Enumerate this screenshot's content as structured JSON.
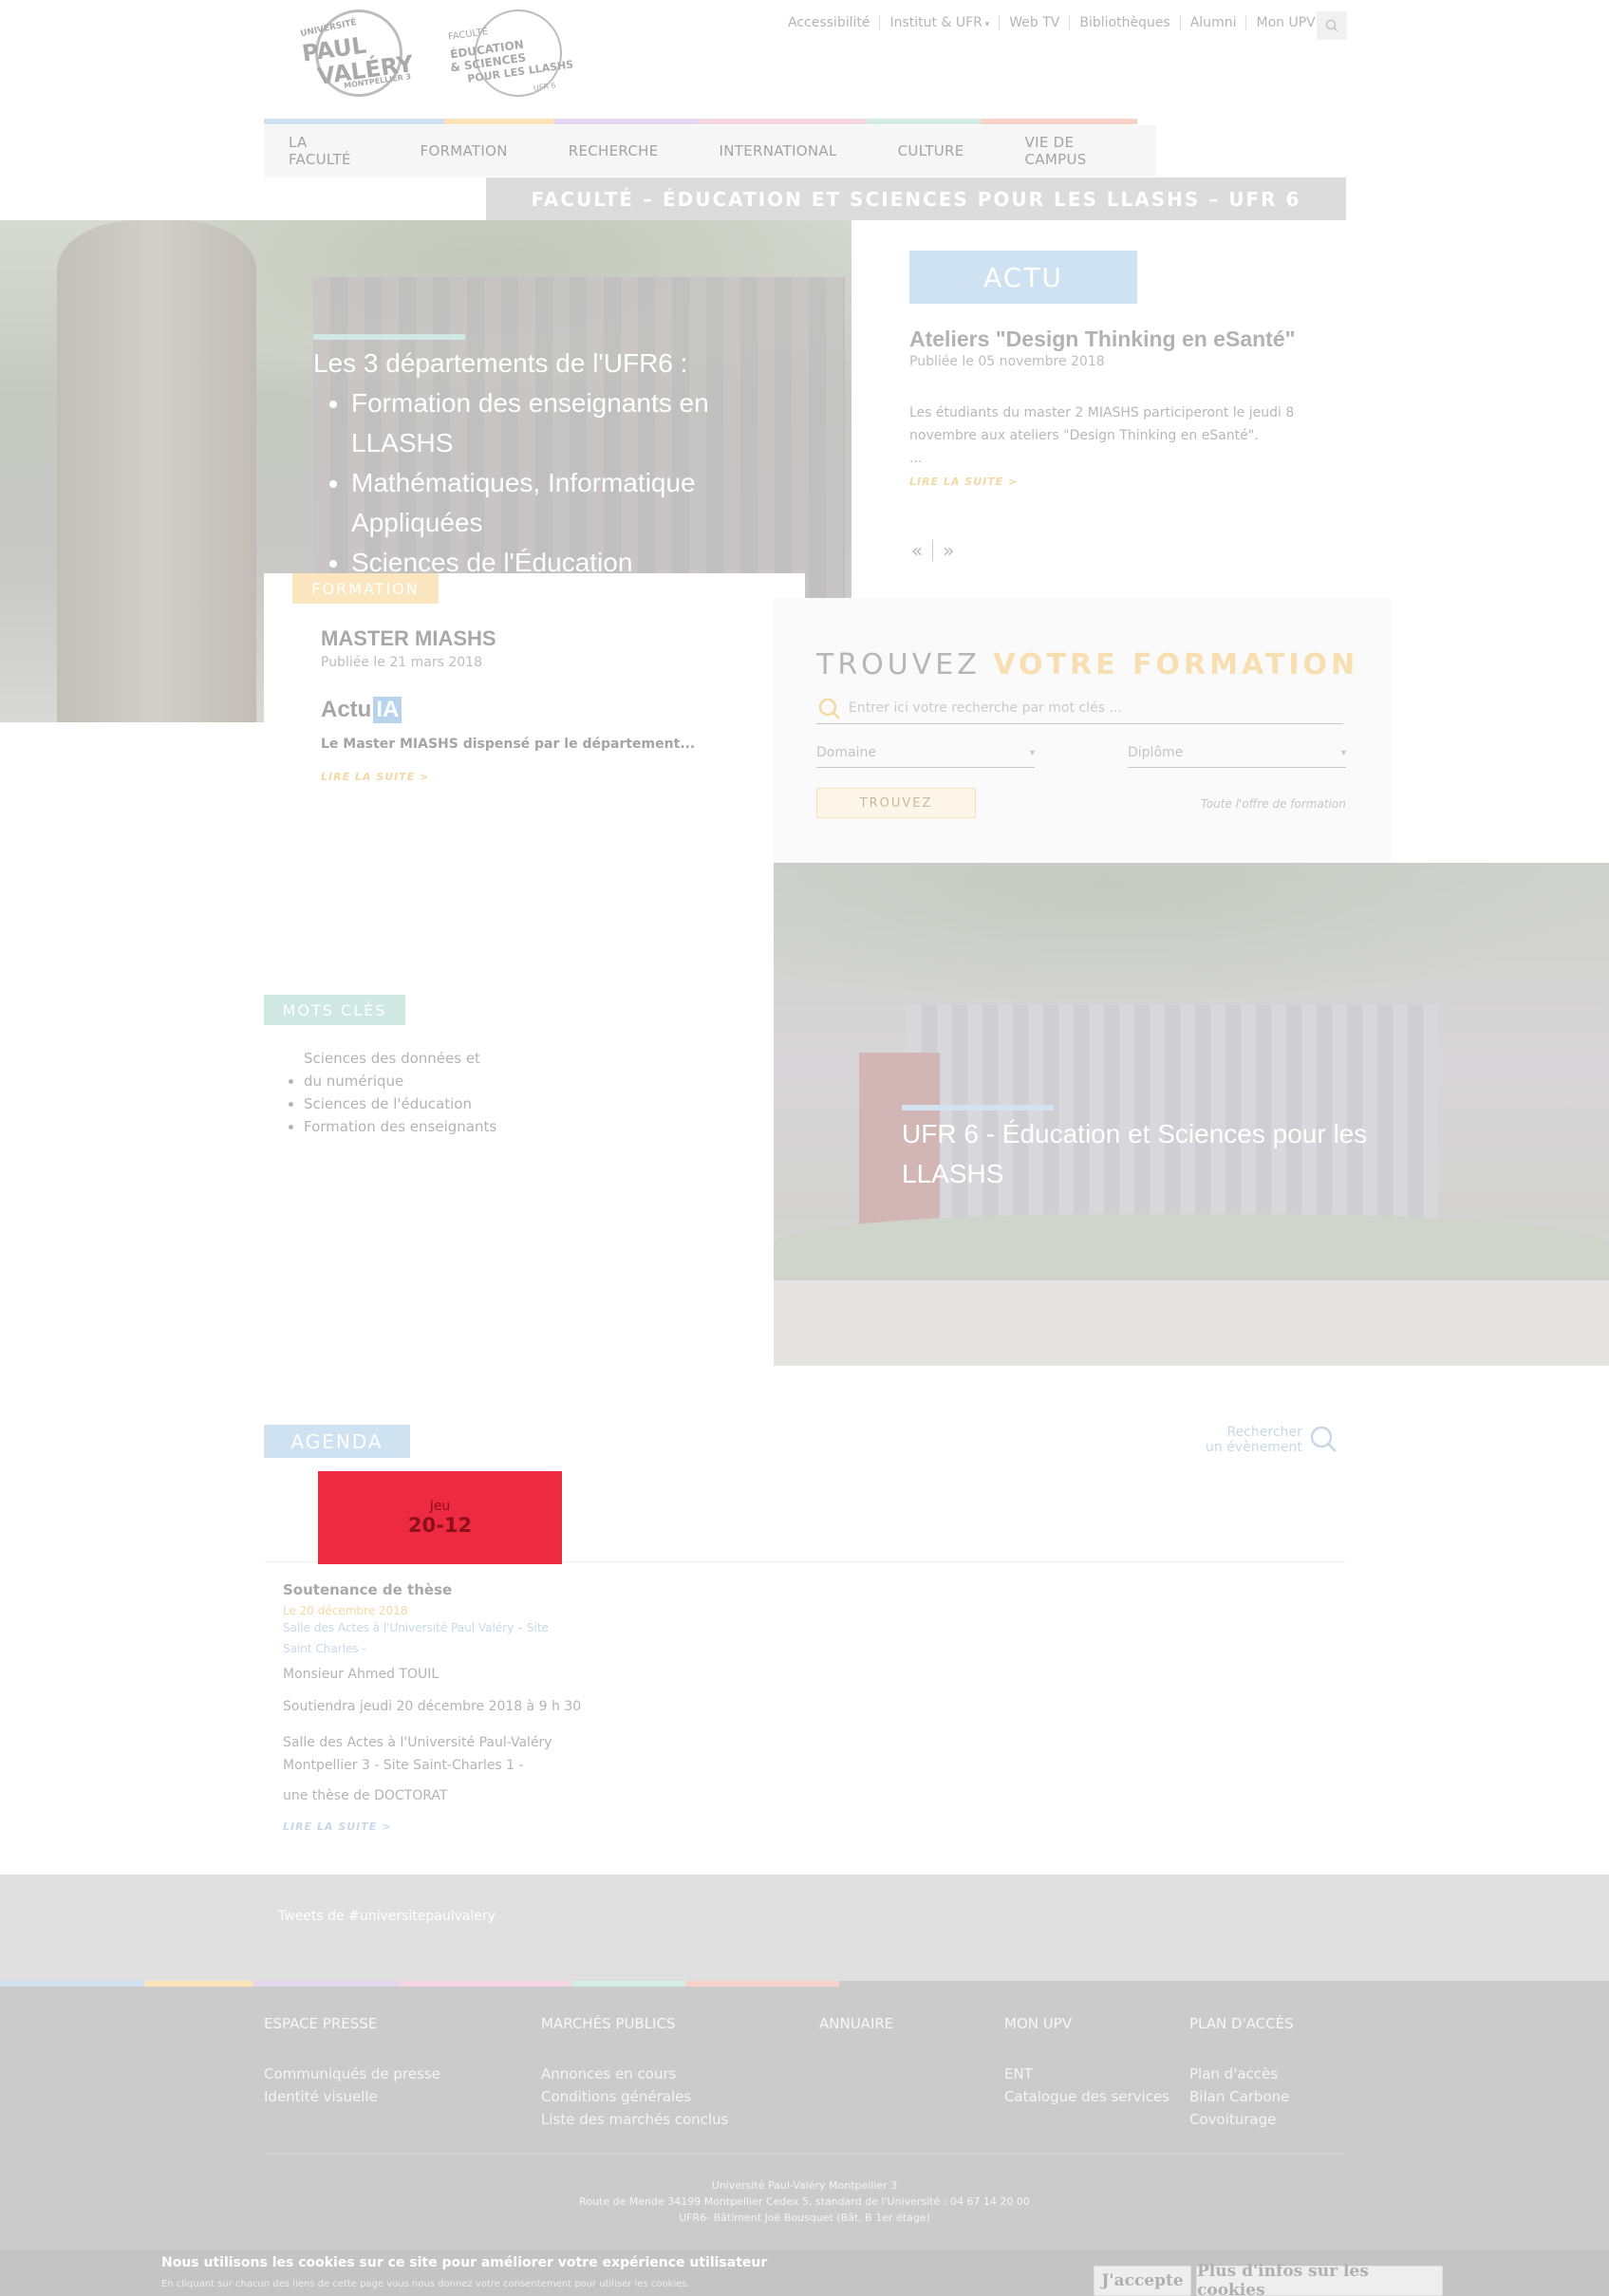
{
  "logo": {
    "university_line1": "UNIVERSITÉ",
    "university_line2": "PAUL",
    "university_line3": "VALÉRY",
    "university_line4": "MONTPELLIER 3",
    "faculty_line1": "FACULTÉ",
    "faculty_line2": "ÉDUCATION",
    "faculty_line3": "& SCIENCES",
    "faculty_line4": "POUR LES LLASHS",
    "faculty_line5": "UFR 6"
  },
  "top_links": [
    "Accessibilité",
    "Institut & UFR",
    "Web TV",
    "Bibliothèques",
    "Alumni",
    "Mon UPV"
  ],
  "nav": [
    "LA FACULTÉ",
    "FORMATION",
    "RECHERCHE",
    "INTERNATIONAL",
    "CULTURE",
    "VIE DE CAMPUS"
  ],
  "banner": "FACULTÉ – ÉDUCATION ET SCIENCES POUR LES LLASHS – UFR 6",
  "hero": {
    "heading": "Les 3 départements de l'UFR6 :",
    "items": [
      "Formation des enseignants en LLASHS",
      "Mathématiques, Informatique Appliquées",
      "Sciences de l'Éducation"
    ]
  },
  "actu": {
    "tag": "ACTU",
    "title": "Ateliers \"Design Thinking en eSanté\"",
    "date": "Publiée le 05 novembre 2018",
    "body": "Les étudiants du master 2 MIASHS participeront le jeudi 8 novembre aux ateliers \"Design Thinking en eSanté\".",
    "ellipsis": "...",
    "more": "LIRE LA SUITE  >",
    "prev": "«",
    "next": "»"
  },
  "formation": {
    "tag": "FORMATION",
    "title": "MASTER MIASHS",
    "date": "Publiée le 21 mars 2018",
    "logo_actu": "Actu",
    "logo_ia": "IA",
    "body": "Le Master MIASHS dispensé par le département...",
    "more": "LIRE LA SUITE  >"
  },
  "finder": {
    "title_plain": "TROUVEZ",
    "title_highlight": "VOTRE FORMATION",
    "search_placeholder": "Entrer ici votre recherche par mot clés ...",
    "domain": "Domaine",
    "diploma": "Diplôme",
    "button": "TROUVEZ",
    "all_link": "Toute l'offre de formation"
  },
  "photo2": {
    "caption": "UFR 6 - Éducation et Sciences pour les LLASHS"
  },
  "keywords": {
    "tag": "MOTS CLÉS",
    "items": [
      "Sciences des données et du numérique",
      "Sciences de l'éducation",
      "Formation des enseignants"
    ]
  },
  "agenda": {
    "tag": "AGENDA",
    "search_line1": "Rechercher",
    "search_line2": "un évènement",
    "day": "Jeu",
    "date": "20-12",
    "event_title": "Soutenance de thèse",
    "event_date": "Le 20 décembre 2018",
    "event_place": "Salle des Actes à l'Université Paul Valéry – Site Saint Charles -",
    "p1": "Monsieur Ahmed TOUIL",
    "p2": "Soutiendra jeudi 20 décembre 2018 à 9 h 30",
    "p3": "Salle des Actes à l'Université Paul-Valéry Montpellier 3 - Site Saint-Charles 1 -",
    "p4": "une thèse de DOCTORAT",
    "more": "LIRE LA SUITE  >"
  },
  "tweets": "Tweets de #universitepaulvalery",
  "footer": {
    "cols": [
      {
        "heading": "ESPACE PRESSE",
        "links": [
          "Communiqués de presse",
          "Identité visuelle"
        ]
      },
      {
        "heading": "MARCHÉS PUBLICS",
        "links": [
          "Annonces en cours",
          "Conditions générales",
          "Liste des marchés conclus"
        ]
      },
      {
        "heading": "ANNUAIRE",
        "links": []
      },
      {
        "heading": "MON UPV",
        "links": [
          "ENT",
          "Catalogue des services"
        ]
      },
      {
        "heading": "PLAN D'ACCÈS",
        "links": [
          "Plan d'accès",
          "Bilan Carbone",
          "Covoiturage"
        ]
      }
    ],
    "address1": "Université Paul-Valéry Montpellier 3",
    "address2": "Route de Mende 34199 Montpellier Cedex 5, standard de l'Université : 04 67 14 20 00",
    "address3": "UFR6- Bâtiment Joë Bousquet (Bât. B 1er étage)"
  },
  "cookie": {
    "title": "Nous utilisons les cookies sur ce site pour améliorer votre expérience utilisateur",
    "sub": "En cliquant sur chacun des liens de cette page vous nous donnez votre consentement pour utiliser les cookies.",
    "accept": "J'accepte",
    "more": "Plus d'infos sur les cookies"
  },
  "colors": {
    "stripe": [
      "#cfe0f0",
      "#fbe4b8",
      "#e3d7ee",
      "#f6d6e2",
      "#d3ece4",
      "#f8d2c8"
    ],
    "actu_tag": "#cfe2f2",
    "formation_tag": "#fbe6bf",
    "keywords_tag": "#cfe9e2",
    "agenda_tag": "#cfe2f2",
    "date_box": "#ee2a41"
  }
}
